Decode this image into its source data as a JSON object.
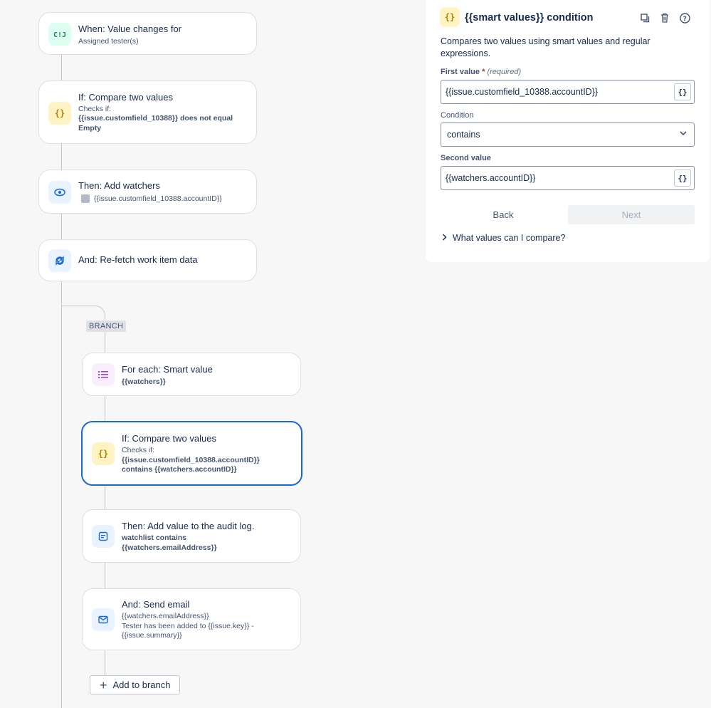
{
  "flow": {
    "trigger": {
      "title": "When: Value changes for",
      "sub": "Assigned tester(s)",
      "icon": "trigger-icon"
    },
    "condition1": {
      "title": "If: Compare two values",
      "checks": "Checks if:",
      "detail": "{{issue.customfield_10388}} does not equal Empty",
      "icon": "braces-icon"
    },
    "watchers": {
      "title": "Then: Add watchers",
      "sub": "{{issue.customfield_10388.accountID}}",
      "icon": "eye-icon"
    },
    "refetch": {
      "title": "And: Re-fetch work item data",
      "icon": "refresh-icon"
    },
    "branch_label": "BRANCH",
    "foreach": {
      "title": "For each: Smart value",
      "sub": "{{watchers}}",
      "icon": "list-icon"
    },
    "condition2": {
      "title": "If: Compare two values",
      "checks": "Checks if:",
      "detail_line1": "{{issue.customfield_10388.accountID}}",
      "detail_line2": "contains {{watchers.accountID}}",
      "icon": "braces-icon"
    },
    "audit": {
      "title": "Then: Add value to the audit log.",
      "line1": "watchlist contains",
      "line2": "{{watchers.emailAddress}}",
      "icon": "document-icon"
    },
    "email": {
      "title": "And: Send email",
      "line1": "{{watchers.emailAddress}}",
      "line2": "Tester has been added to {{issue.key}} -",
      "line3": "{{issue.summary}}",
      "icon": "mail-icon"
    },
    "add_to_branch": "Add to branch"
  },
  "panel": {
    "title": "{{smart values}} condition",
    "description": "Compares two values using smart values and regular expressions.",
    "first_value_label": "First value",
    "required_marker": "*",
    "required_text": "(required)",
    "first_value": "{{issue.customfield_10388.accountID}}",
    "condition_label": "Condition",
    "condition_value": "contains",
    "second_value_label": "Second value",
    "second_value": "{{watchers.accountID}}",
    "back_label": "Back",
    "next_label": "Next",
    "expander_label": "What values can I compare?",
    "actions": [
      "copy-icon",
      "trash-icon",
      "help-icon"
    ]
  },
  "colors": {
    "accent": "#1868db",
    "green": "#1f845a",
    "yellow": "#b38600",
    "purple": "#964ac0"
  }
}
